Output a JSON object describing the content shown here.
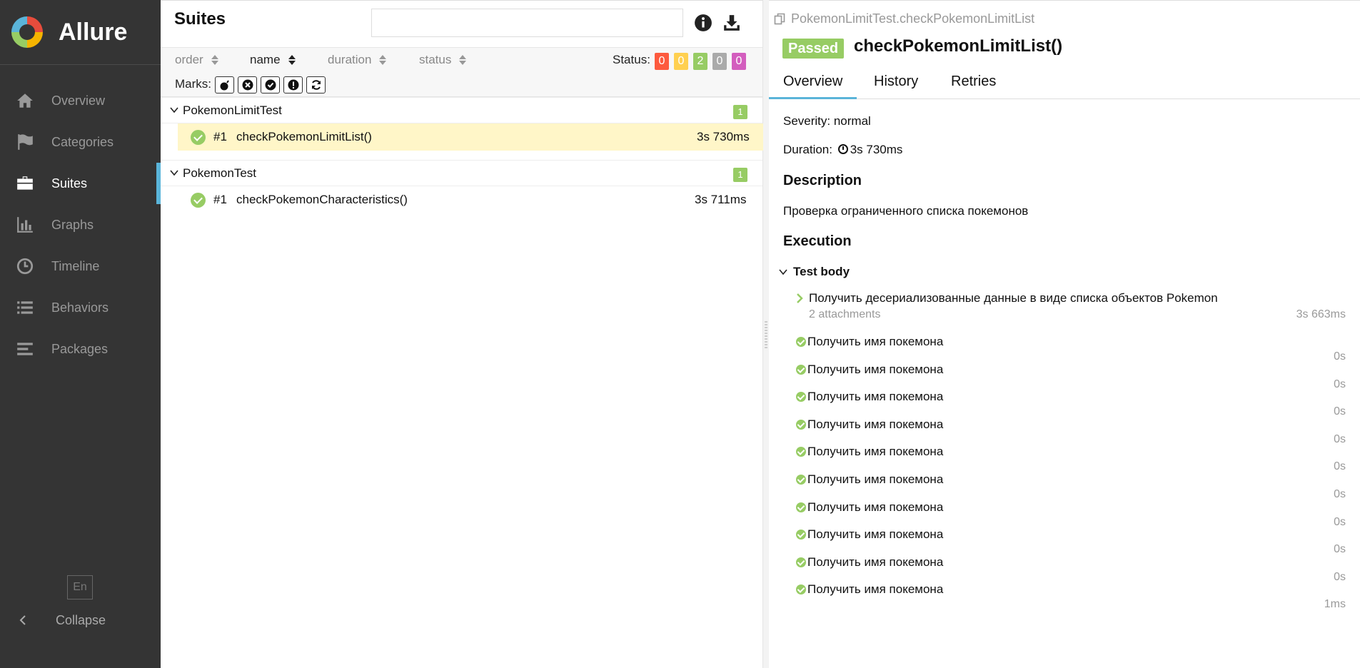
{
  "sidebar": {
    "brand": "Allure",
    "items": [
      {
        "label": "Overview",
        "icon": "home-icon"
      },
      {
        "label": "Categories",
        "icon": "flag-icon"
      },
      {
        "label": "Suites",
        "icon": "briefcase-icon",
        "active": true
      },
      {
        "label": "Graphs",
        "icon": "bar-chart-icon"
      },
      {
        "label": "Timeline",
        "icon": "clock-icon"
      },
      {
        "label": "Behaviors",
        "icon": "list-icon"
      },
      {
        "label": "Packages",
        "icon": "align-left-icon"
      }
    ],
    "lang": "En",
    "collapse": "Collapse"
  },
  "suites": {
    "title": "Suites",
    "search_value": "",
    "sort": {
      "order": "order",
      "name": "name",
      "duration": "duration",
      "status": "status"
    },
    "status_label": "Status:",
    "status_counts": [
      {
        "value": "0",
        "color": "#fd5a3e"
      },
      {
        "value": "0",
        "color": "#ffd050"
      },
      {
        "value": "2",
        "color": "#97cc64"
      },
      {
        "value": "0",
        "color": "#aaaaaa"
      },
      {
        "value": "0",
        "color": "#d35ebe"
      }
    ],
    "marks_label": "Marks:",
    "groups": [
      {
        "name": "PokemonLimitTest",
        "count": "1",
        "tests": [
          {
            "num": "#1",
            "name": "checkPokemonLimitList()",
            "duration": "3s 730ms",
            "selected": true
          }
        ]
      },
      {
        "name": "PokemonTest",
        "count": "1",
        "tests": [
          {
            "num": "#1",
            "name": "checkPokemonCharacteristics()",
            "duration": "3s 711ms",
            "selected": false
          }
        ]
      }
    ]
  },
  "result": {
    "breadcrumb": "PokemonLimitTest.checkPokemonLimitList",
    "status": "Passed",
    "title": "checkPokemonLimitList()",
    "tabs": [
      "Overview",
      "History",
      "Retries"
    ],
    "severity": "Severity: normal",
    "duration_label": "Duration:",
    "duration_value": "3s 730ms",
    "description_heading": "Description",
    "description": "Проверка ограниченного списка покемонов",
    "execution_heading": "Execution",
    "test_body": "Test body",
    "first_step": "Получить десериализованные данные в виде списка объектов Pokemon",
    "first_step_attachments": "2 attachments",
    "first_step_duration": "3s 663ms",
    "steps": [
      {
        "name": "Получить имя покемона",
        "duration": "0s"
      },
      {
        "name": "Получить имя покемона",
        "duration": "0s"
      },
      {
        "name": "Получить имя покемона",
        "duration": "0s"
      },
      {
        "name": "Получить имя покемона",
        "duration": "0s"
      },
      {
        "name": "Получить имя покемона",
        "duration": "0s"
      },
      {
        "name": "Получить имя покемона",
        "duration": "0s"
      },
      {
        "name": "Получить имя покемона",
        "duration": "0s"
      },
      {
        "name": "Получить имя покемона",
        "duration": "0s"
      },
      {
        "name": "Получить имя покемона",
        "duration": "0s"
      },
      {
        "name": "Получить имя покемона",
        "duration": "1ms"
      }
    ]
  }
}
